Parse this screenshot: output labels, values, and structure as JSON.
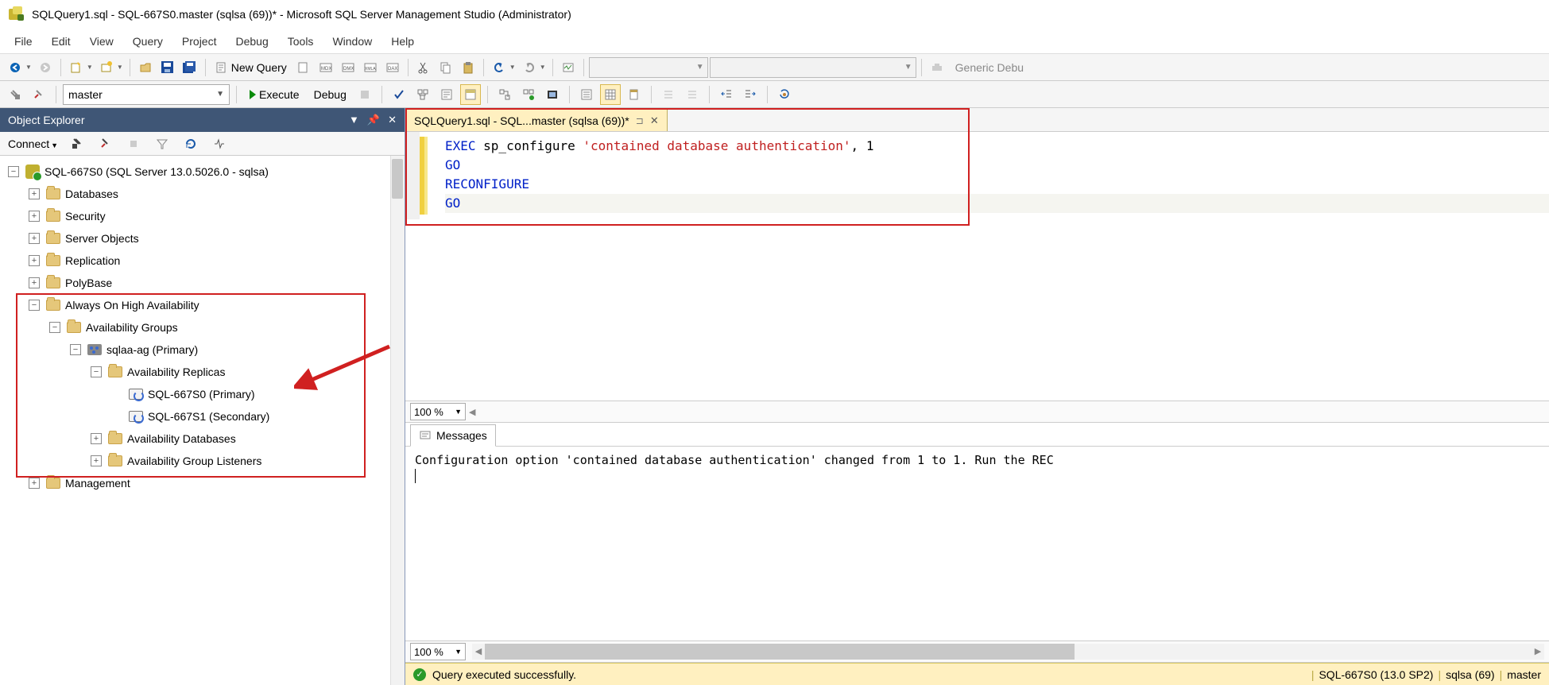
{
  "window": {
    "title": "SQLQuery1.sql - SQL-667S0.master (sqlsa (69))* - Microsoft SQL Server Management Studio (Administrator)"
  },
  "menu": {
    "file": "File",
    "edit": "Edit",
    "view": "View",
    "query": "Query",
    "project": "Project",
    "debug": "Debug",
    "tools": "Tools",
    "window": "Window",
    "help": "Help"
  },
  "toolbar": {
    "new_query": "New Query",
    "generic": "Generic Debu",
    "db_selected": "master",
    "execute": "Execute",
    "debug": "Debug"
  },
  "objectExplorer": {
    "title": "Object Explorer",
    "connect": "Connect",
    "server": "SQL-667S0 (SQL Server 13.0.5026.0 - sqlsa)",
    "folders": {
      "databases": "Databases",
      "security": "Security",
      "serverObjects": "Server Objects",
      "replication": "Replication",
      "polybase": "PolyBase",
      "alwaysOn": "Always On High Availability",
      "availGroups": "Availability Groups",
      "agName": "sqlaa-ag (Primary)",
      "replicas": "Availability Replicas",
      "rep0": "SQL-667S0 (Primary)",
      "rep1": "SQL-667S1 (Secondary)",
      "availDbs": "Availability Databases",
      "listeners": "Availability Group Listeners",
      "management": "Management"
    }
  },
  "tab": {
    "label": "SQLQuery1.sql - SQL...master (sqlsa (69))*"
  },
  "code": {
    "l1a": "EXEC",
    "l1b": " sp_configure ",
    "l1c": "'contained database authentication'",
    "l1d": ", 1",
    "l2": "GO",
    "l3": "RECONFIGURE",
    "l4": "GO"
  },
  "zoom": {
    "value": "100 %"
  },
  "messages": {
    "tab": "Messages",
    "body": "Configuration option 'contained database authentication' changed from 1 to 1. Run the REC"
  },
  "status": {
    "text": "Query executed successfully.",
    "server": "SQL-667S0 (13.0 SP2)",
    "user": "sqlsa (69)",
    "db": "master"
  }
}
